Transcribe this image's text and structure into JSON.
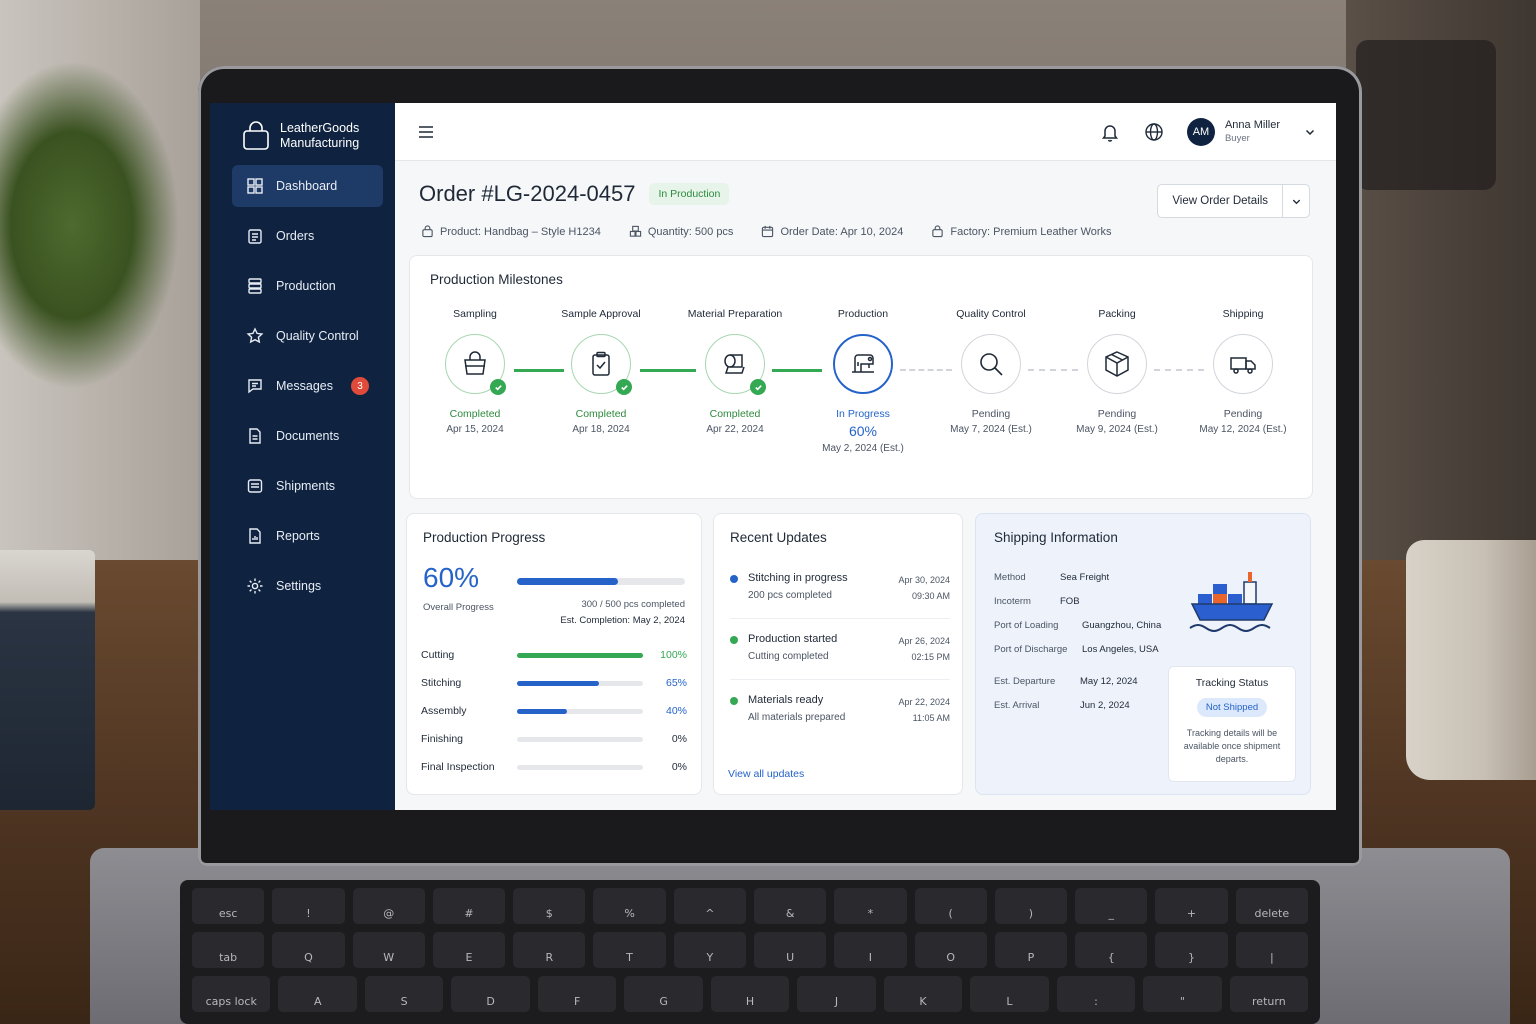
{
  "brand": {
    "name_line1": "LeatherGoods",
    "name_line2": "Manufacturing"
  },
  "sidebar": {
    "items": [
      {
        "label": "Dashboard",
        "icon": "grid-icon",
        "active": true
      },
      {
        "label": "Orders",
        "icon": "clipboard-icon"
      },
      {
        "label": "Production",
        "icon": "stack-icon"
      },
      {
        "label": "Quality Control",
        "icon": "star-icon"
      },
      {
        "label": "Messages",
        "icon": "message-icon",
        "badge": "3"
      },
      {
        "label": "Documents",
        "icon": "document-icon"
      },
      {
        "label": "Shipments",
        "icon": "box-icon"
      },
      {
        "label": "Reports",
        "icon": "report-icon"
      },
      {
        "label": "Settings",
        "icon": "gear-icon"
      }
    ]
  },
  "topbar": {
    "user_initials": "AM",
    "user_name": "Anna Miller",
    "user_role": "Buyer"
  },
  "order": {
    "title": "Order #LG-2024-0457",
    "status": "In Production",
    "view_details": "View Order Details",
    "product": "Product: Handbag – Style H1234",
    "quantity": "Quantity: 500 pcs",
    "order_date": "Order Date: Apr 10, 2024",
    "factory": "Factory: Premium Leather Works"
  },
  "milestones": {
    "title": "Production Milestones",
    "items": [
      {
        "name": "Sampling",
        "status": "Completed",
        "date": "Apr 15, 2024",
        "icon": "handbag-icon"
      },
      {
        "name": "Sample Approval",
        "status": "Completed",
        "date": "Apr 18, 2024",
        "icon": "clipboard-check-icon"
      },
      {
        "name": "Material Preparation",
        "status": "Completed",
        "date": "Apr 22, 2024",
        "icon": "leather-roll-icon"
      },
      {
        "name": "Production",
        "status": "In Progress",
        "percent": "60%",
        "date": "May 2, 2024 (Est.)",
        "icon": "sewing-machine-icon"
      },
      {
        "name": "Quality Control",
        "status": "Pending",
        "date": "May 7, 2024 (Est.)",
        "icon": "magnifier-icon"
      },
      {
        "name": "Packing",
        "status": "Pending",
        "date": "May 9, 2024 (Est.)",
        "icon": "package-icon"
      },
      {
        "name": "Shipping",
        "status": "Pending",
        "date": "May 12, 2024 (Est.)",
        "icon": "truck-icon"
      }
    ]
  },
  "progress": {
    "title": "Production Progress",
    "overall_percent": "60%",
    "overall_value": 0.6,
    "overall_label": "Overall Progress",
    "pcs": "300 / 500 pcs completed",
    "est": "Est. Completion: May 2, 2024",
    "stages": [
      {
        "label": "Cutting",
        "pct": "100%",
        "value": 1.0,
        "color": "#34a853"
      },
      {
        "label": "Stitching",
        "pct": "65%",
        "value": 0.65,
        "color": "#2563c9"
      },
      {
        "label": "Assembly",
        "pct": "40%",
        "value": 0.4,
        "color": "#2563c9"
      },
      {
        "label": "Finishing",
        "pct": "0%",
        "value": 0,
        "color": "#2563c9"
      },
      {
        "label": "Final Inspection",
        "pct": "0%",
        "value": 0,
        "color": "#2563c9"
      }
    ]
  },
  "updates": {
    "title": "Recent Updates",
    "items": [
      {
        "title": "Stitching in progress",
        "sub": "200 pcs completed",
        "date": "Apr 30, 2024",
        "time": "09:30 AM",
        "color": "#2563c9"
      },
      {
        "title": "Production started",
        "sub": "Cutting completed",
        "date": "Apr 26, 2024",
        "time": "02:15 PM",
        "color": "#34a853"
      },
      {
        "title": "Materials ready",
        "sub": "All materials prepared",
        "date": "Apr 22, 2024",
        "time": "11:05 AM",
        "color": "#34a853"
      }
    ],
    "view_all": "View all updates"
  },
  "shipping": {
    "title": "Shipping Information",
    "method_k": "Method",
    "method_v": "Sea Freight",
    "incoterm_k": "Incoterm",
    "incoterm_v": "FOB",
    "pol_k": "Port of Loading",
    "pol_v": "Guangzhou, China",
    "pod_k": "Port of Discharge",
    "pod_v": "Los Angeles, USA",
    "dep_k": "Est. Departure",
    "dep_v": "May 12, 2024",
    "arr_k": "Est. Arrival",
    "arr_v": "Jun 2, 2024",
    "tracking_title": "Tracking Status",
    "tracking_status": "Not Shipped",
    "tracking_note": "Tracking details will be available once shipment departs."
  }
}
